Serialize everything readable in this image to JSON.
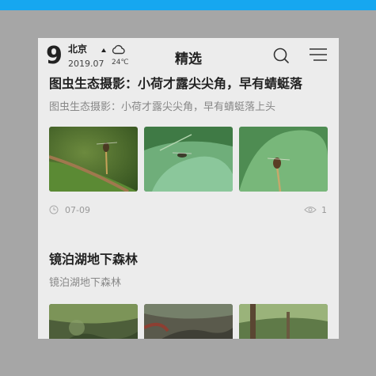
{
  "header": {
    "day": "9",
    "city": "北京",
    "date": "2019.07",
    "temperature": "24℃",
    "weather_icon": "cloud-icon",
    "title": "精选",
    "search_icon": "search-icon",
    "menu_icon": "menu-icon"
  },
  "articles": [
    {
      "title": "图虫生态摄影：小荷才露尖尖角，早有蜻蜓落",
      "subtitle": "图虫生态摄影：小荷才露尖尖角，早有蜻蜓落上头",
      "date": "07-09",
      "views": "1"
    },
    {
      "title": "镜泊湖地下森林",
      "subtitle": "镜泊湖地下森林"
    }
  ],
  "colors": {
    "status_bar": "#16a7f0",
    "backdrop": "#a6a6a6",
    "page_background": "#ececec"
  }
}
